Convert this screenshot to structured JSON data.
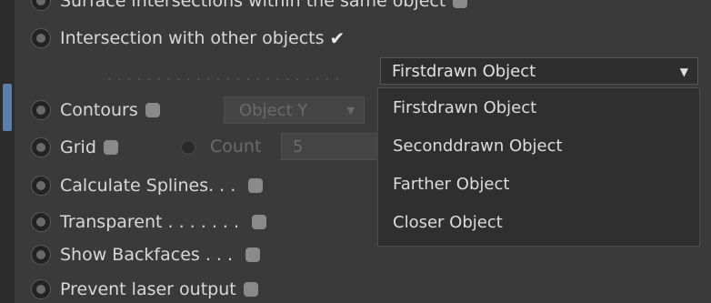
{
  "rows": {
    "top_cut_label": "Surface intersections within the same object",
    "intersection_label": "Intersection with other objects",
    "contours_label": "Contours",
    "grid_label": "Grid",
    "calc_splines_label": "Calculate Splines. . .",
    "transparent_label": "Transparent . . . . . . .",
    "show_backfaces_label": "Show Backfaces . . .",
    "prevent_laser_label": "Prevent laser output"
  },
  "intersection_checked": true,
  "dropdown": {
    "selected": "Firstdrawn Object",
    "options": [
      "Firstdrawn Object",
      "Seconddrawn Object",
      "Farther Object",
      "Closer Object"
    ]
  },
  "contours_axis": "Object Y",
  "grid": {
    "count_label": "Count",
    "count_value": "5"
  },
  "separator_dots": ". . . . . . . . . . . . . . . . . . . . . . . ."
}
